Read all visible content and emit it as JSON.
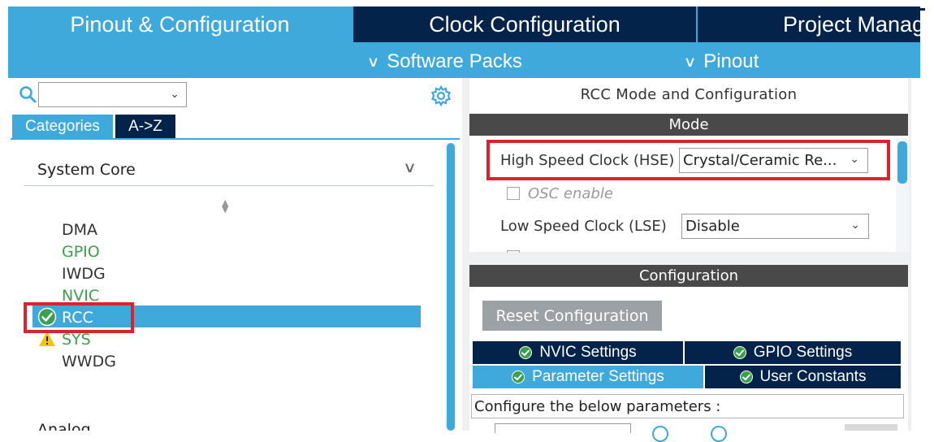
{
  "tabs": {
    "pinout": "Pinout & Configuration",
    "clock": "Clock Configuration",
    "project": "Project Manager"
  },
  "subnav": {
    "software_packs": "Software Packs",
    "pinout": "Pinout"
  },
  "left": {
    "search_value": "",
    "tab_categories": "Categories",
    "tab_az": "A->Z",
    "section_title": "System Core",
    "items": [
      "DMA",
      "GPIO",
      "IWDG",
      "NVIC",
      "RCC",
      "SYS",
      "WWDG"
    ],
    "item_status": {
      "GPIO": "configured",
      "NVIC": "configured",
      "RCC": "selected-ok",
      "SYS": "warning"
    },
    "next_section_partial": "Analog"
  },
  "right": {
    "title": "RCC Mode and Configuration",
    "mode_header": "Mode",
    "hse_label": "High Speed Clock (HSE)",
    "hse_value": "Crystal/Ceramic Re...",
    "osc_label": "OSC enable",
    "lse_label": "Low Speed Clock (LSE)",
    "lse_value": "Disable",
    "config_header": "Configuration",
    "reset_button": "Reset Configuration",
    "settings_tabs": {
      "nvic": "NVIC Settings",
      "gpio": "GPIO Settings",
      "parameter": "Parameter Settings",
      "user": "User Constants"
    },
    "param_info": "Configure the below parameters :"
  },
  "colors": {
    "accent_blue": "#3fa9dc",
    "navy": "#03234b",
    "dark_gray_header": "#494949",
    "highlight_red": "#d9232d",
    "ok_green": "#3c9f4c",
    "warning_yellow": "#f2c500"
  }
}
